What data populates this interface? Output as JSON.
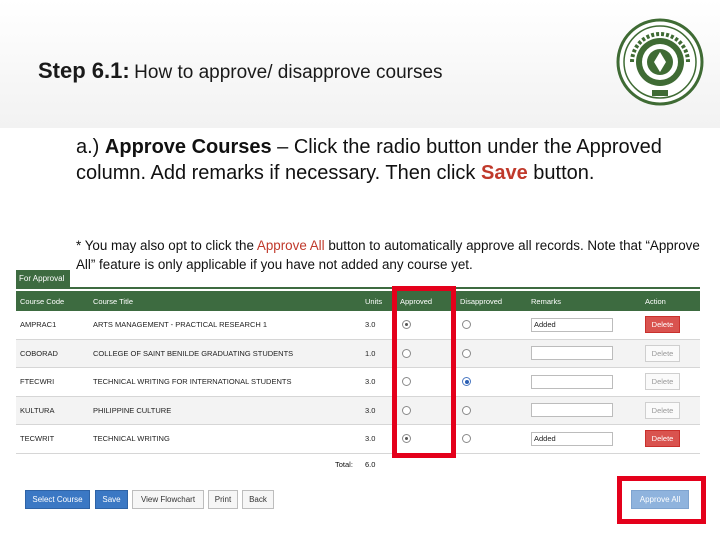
{
  "slide": {
    "step": "Step 6.1:",
    "title_rest": "How to approve/ disapprove courses",
    "instruction": {
      "prefix": "a.) ",
      "label": "Approve Courses",
      "text_1": " – Click the radio button under the Approved column. Add remarks if necessary.  Then click ",
      "save_word": "Save",
      "text_2": " button."
    },
    "note": {
      "part_1": "* You may also opt to click the ",
      "approve_all": "Approve All",
      "part_2": " button to automatically approve all records. Note that “Approve All” feature is only applicable if you have not added any course yet."
    },
    "logo_alt": "college-seal"
  },
  "app": {
    "tab_label": "For Approval",
    "columns": {
      "code": "Course Code",
      "title": "Course Title",
      "units": "Units",
      "approved": "Approved",
      "disapproved": "Disapproved",
      "remarks": "Remarks",
      "action": "Action"
    },
    "rows": [
      {
        "code": "AMPRAC1",
        "title": "ARTS MANAGEMENT - PRACTICAL RESEARCH 1",
        "units": "3.0",
        "approved": true,
        "disapproved": false,
        "remarks": "Added",
        "action": "Delete",
        "delete_active": true
      },
      {
        "code": "COBORAD",
        "title": "COLLEGE OF SAINT BENILDE GRADUATING STUDENTS",
        "units": "1.0",
        "approved": false,
        "disapproved": false,
        "remarks": "",
        "action": "Delete",
        "delete_active": false
      },
      {
        "code": "FTECWRI",
        "title": "TECHNICAL WRITING FOR INTERNATIONAL STUDENTS",
        "units": "3.0",
        "approved": false,
        "disapproved": true,
        "remarks": "",
        "action": "Delete",
        "delete_active": false
      },
      {
        "code": "KULTURA",
        "title": "PHILIPPINE CULTURE",
        "units": "3.0",
        "approved": false,
        "disapproved": false,
        "remarks": "",
        "action": "Delete",
        "delete_active": false
      },
      {
        "code": "TECWRIT",
        "title": "TECHNICAL WRITING",
        "units": "3.0",
        "approved": true,
        "disapproved": false,
        "remarks": "Added",
        "action": "Delete",
        "delete_active": true
      }
    ],
    "total_label": "Total:",
    "total_value": "6.0",
    "buttons": {
      "select_course": "Select Course",
      "save": "Save",
      "view_flowchart": "View Flowchart",
      "print": "Print",
      "back": "Back",
      "approve_all": "Approve All"
    }
  },
  "colors": {
    "header_green": "#3d6b40",
    "highlight_red": "#e4001b",
    "delete_red": "#d9534f",
    "primary_blue": "#3b78c4",
    "accent_text_red": "#c0392b"
  }
}
